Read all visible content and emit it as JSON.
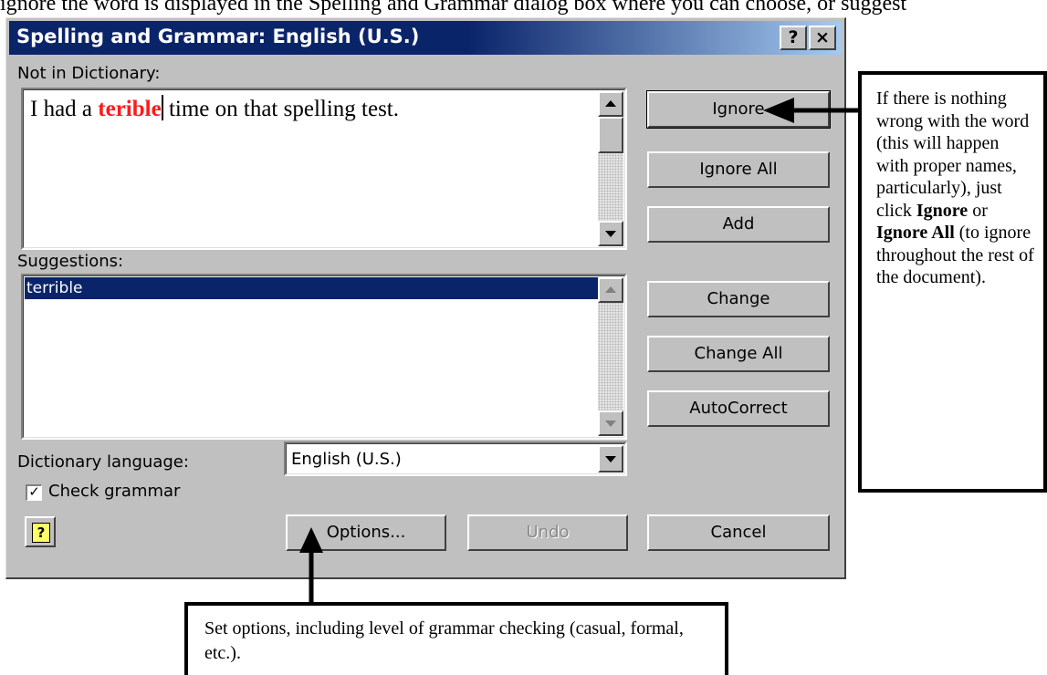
{
  "doc_top_text": "ignore the word is displayed in the Spelling and Grammar dialog box where you can choose, or suggest",
  "dialog": {
    "title": "Spelling and Grammar: English (U.S.)",
    "title_help": "?",
    "title_close": "×",
    "not_in_dictionary_label": "Not in Dictionary:",
    "sentence_before": "I had a ",
    "error_word": "terible",
    "sentence_after": " time on that spelling test.",
    "suggestions_label": "Suggestions:",
    "suggestions": [
      "terrible"
    ],
    "dictionary_language_label": "Dictionary language:",
    "dictionary_language_value": "English (U.S.)",
    "check_grammar_label": "Check grammar",
    "check_grammar_checked": true,
    "buttons": {
      "ignore": "Ignore",
      "ignore_all": "Ignore All",
      "add": "Add",
      "change": "Change",
      "change_all": "Change All",
      "autocorrect": "AutoCorrect",
      "options": "Options...",
      "undo": "Undo",
      "cancel": "Cancel"
    }
  },
  "callouts": {
    "right": {
      "t1": "If there is nothing wrong with the word (this will happen with proper names, particularly), just click ",
      "b1": "Ignore",
      "t2": " or ",
      "b2": "Ignore All",
      "t3": " (to ignore throughout the rest of the document)."
    },
    "bottom": "Set options, including level of grammar checking (casual, formal, etc.)."
  },
  "colors": {
    "title_bar": "#0a246a",
    "dialog_face": "#c0c0c0",
    "error_word": "#ff1a1a",
    "selection": "#0a246a"
  }
}
